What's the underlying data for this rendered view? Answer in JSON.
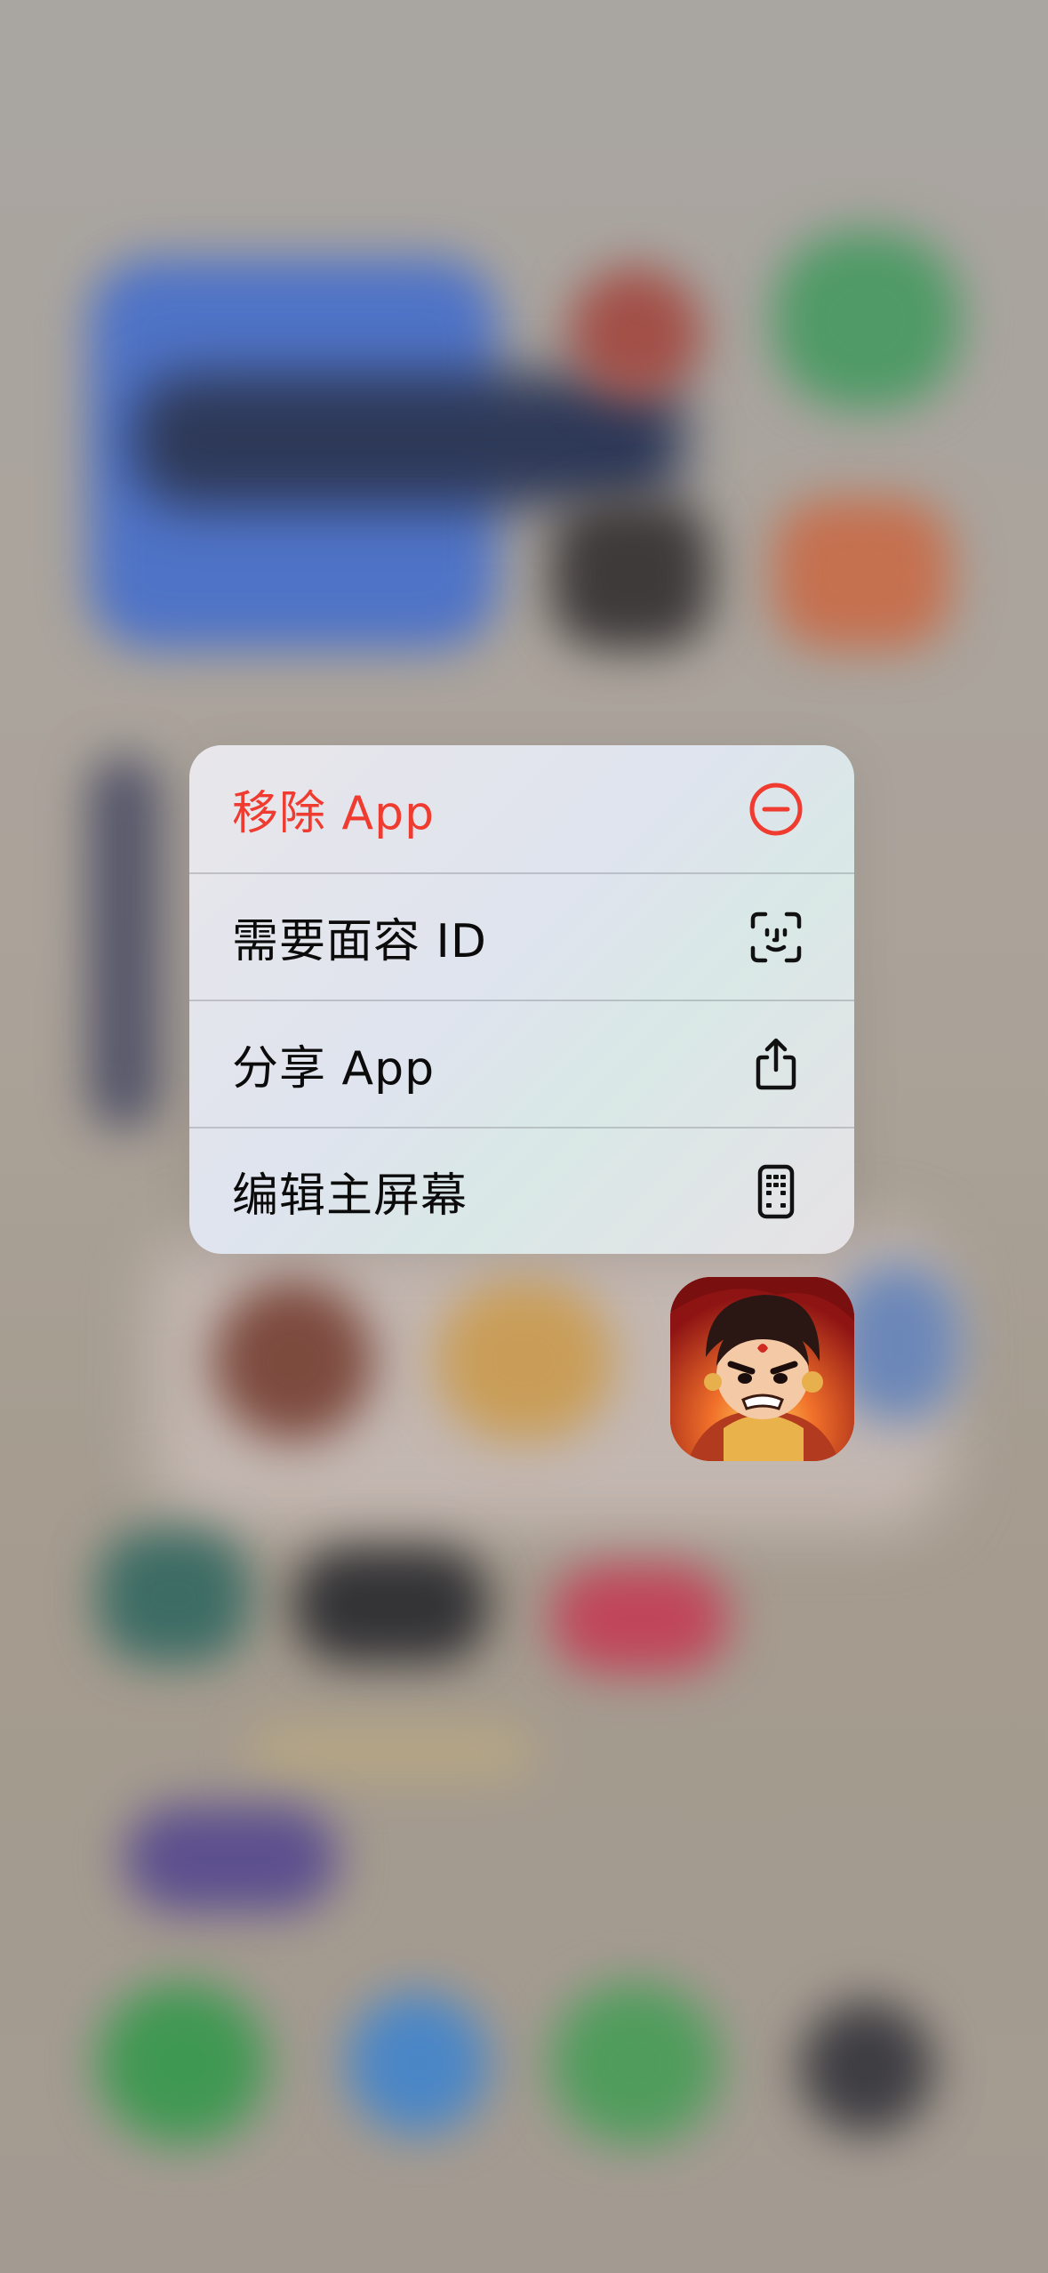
{
  "menu": {
    "items": [
      {
        "label": "移除 App",
        "icon": "minus-circle-icon",
        "destructive": true
      },
      {
        "label": "需要面容 ID",
        "icon": "face-id-icon",
        "destructive": false
      },
      {
        "label": "分享 App",
        "icon": "share-icon",
        "destructive": false
      },
      {
        "label": "编辑主屏幕",
        "icon": "phone-apps-icon",
        "destructive": false
      }
    ]
  },
  "colors": {
    "destructive": "#ef3b30",
    "text": "#0b0b0b"
  },
  "app_icon": {
    "icon": "game-hero-app-icon"
  }
}
